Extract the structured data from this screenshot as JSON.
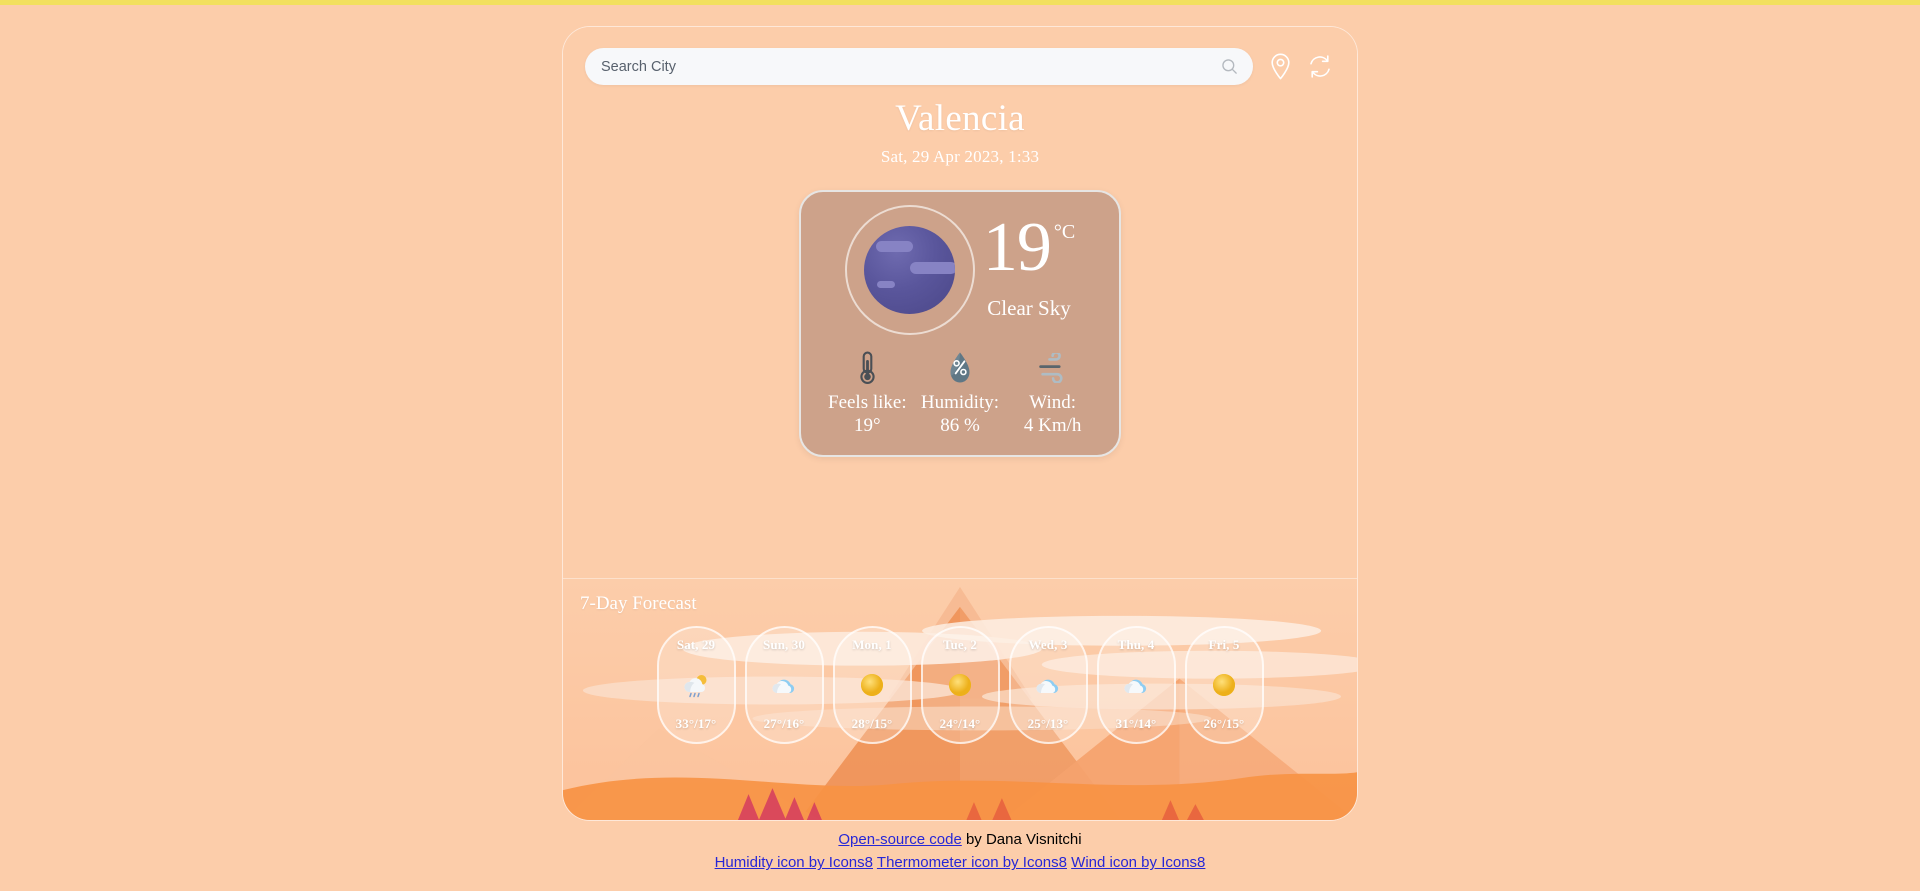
{
  "theme": {
    "page_background": "#fccdaa",
    "top_strip": "#f2e05e",
    "card_background": "#cda28a",
    "text_on_card": "#ffffff",
    "link_color": "#2727d6"
  },
  "search": {
    "placeholder": "Search City",
    "value": "",
    "search_icon": "search-icon",
    "location_icon": "location-pin-icon",
    "refresh_icon": "refresh-icon"
  },
  "header": {
    "city": "Valencia",
    "datetime": "Sat, 29 Apr 2023, 1:33"
  },
  "current": {
    "weather_icon": "night-clear-moon-icon",
    "temperature": "19",
    "unit": "°C",
    "condition": "Clear Sky",
    "stats": [
      {
        "icon": "thermometer-icon",
        "label": "Feels like:",
        "value": "19°"
      },
      {
        "icon": "humidity-droplet-icon",
        "label": "Humidity:",
        "value": "86 %"
      },
      {
        "icon": "wind-icon",
        "label": "Wind:",
        "value": "4 Km/h"
      }
    ]
  },
  "forecast": {
    "title": "7-Day Forecast",
    "days": [
      {
        "day": "Sat, 29",
        "icon": "rain-sun-cloud-icon",
        "temps": "33°/17°",
        "high": 33,
        "low": 17
      },
      {
        "day": "Sun, 30",
        "icon": "cloud-icon",
        "temps": "27°/16°",
        "high": 27,
        "low": 16
      },
      {
        "day": "Mon, 1",
        "icon": "sun-icon",
        "temps": "28°/15°",
        "high": 28,
        "low": 15
      },
      {
        "day": "Tue, 2",
        "icon": "sun-icon",
        "temps": "24°/14°",
        "high": 24,
        "low": 14
      },
      {
        "day": "Wed, 3",
        "icon": "cloud-icon",
        "temps": "25°/13°",
        "high": 25,
        "low": 13
      },
      {
        "day": "Thu, 4",
        "icon": "cloud-icon",
        "temps": "31°/14°",
        "high": 31,
        "low": 14
      },
      {
        "day": "Fri, 5",
        "icon": "sun-icon",
        "temps": "26°/15°",
        "high": 26,
        "low": 15
      }
    ]
  },
  "footer": {
    "source_link": "Open-source code",
    "author_text": " by Dana Visnitchi",
    "credits": [
      "Humidity icon by Icons8",
      "Thermometer icon by Icons8",
      "Wind icon by Icons8"
    ]
  }
}
